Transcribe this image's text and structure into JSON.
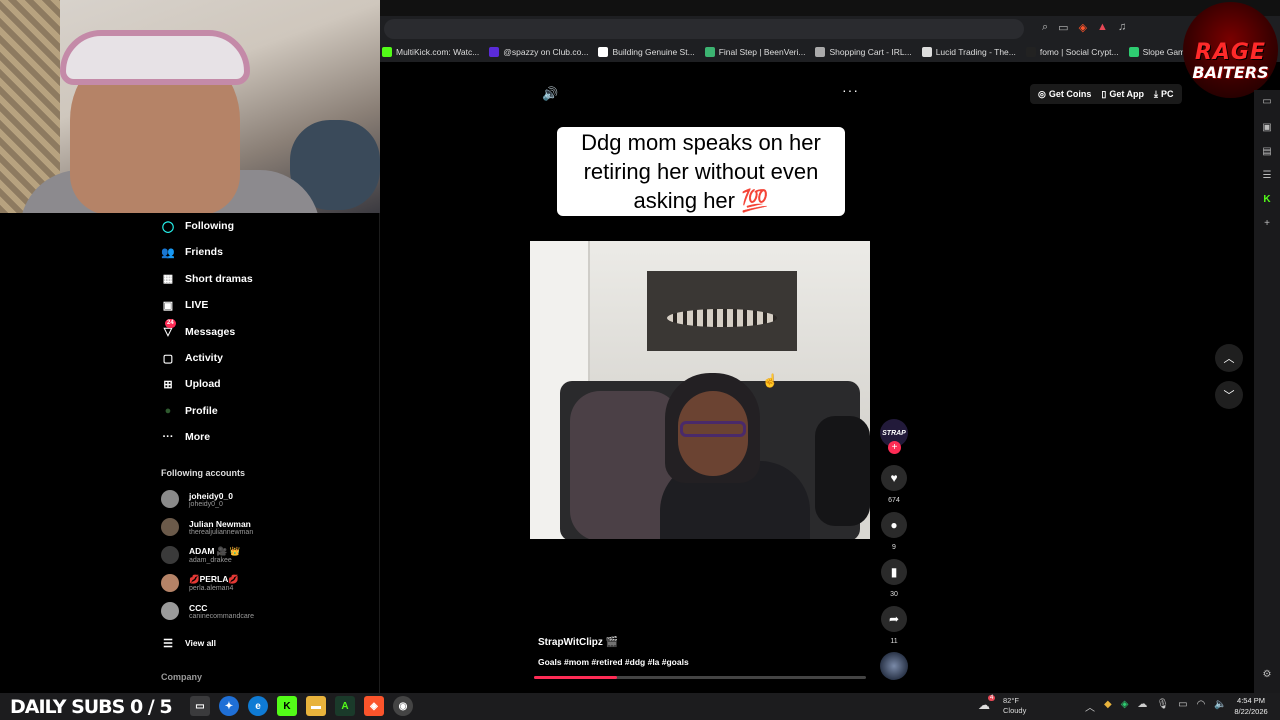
{
  "browser": {
    "bookmarks": [
      {
        "label": "MultiKick.com: Watc...",
        "color": "#53fc18",
        "icon": "kick-icon"
      },
      {
        "label": "@spazzy on Club.co...",
        "color": "#5a2bd9",
        "icon": "club-icon"
      },
      {
        "label": "Building Genuine St...",
        "color": "#ffffff",
        "icon": "globe-icon"
      },
      {
        "label": "Final Step | BeenVeri...",
        "color": "#3cb371",
        "icon": "beenverified-icon"
      },
      {
        "label": "Shopping Cart - IRL...",
        "color": "#aaaaaa",
        "icon": "globe-icon"
      },
      {
        "label": "Lucid Trading - The...",
        "color": "#dddddd",
        "icon": "lucid-icon"
      },
      {
        "label": "fomo | Social Crypt...",
        "color": "#222222",
        "icon": "fomo-icon"
      },
      {
        "label": "Slope Game",
        "color": "#2ecc71",
        "icon": "slope-icon"
      }
    ]
  },
  "logo": {
    "line1": "RAGE",
    "line2": "BAITERS"
  },
  "header_actions": {
    "coins": "Get Coins",
    "app": "Get App",
    "pc": "PC"
  },
  "sidebar": {
    "items": [
      {
        "label": "Following",
        "icon": "following-icon",
        "glyph": "◯"
      },
      {
        "label": "Friends",
        "icon": "friends-icon",
        "glyph": "👥"
      },
      {
        "label": "Short dramas",
        "icon": "short-dramas-icon",
        "glyph": "▦"
      },
      {
        "label": "LIVE",
        "icon": "live-icon",
        "glyph": "▣"
      },
      {
        "label": "Messages",
        "icon": "messages-icon",
        "glyph": "▽",
        "badge": "24"
      },
      {
        "label": "Activity",
        "icon": "activity-icon",
        "glyph": "▢"
      },
      {
        "label": "Upload",
        "icon": "upload-icon",
        "glyph": "⊞"
      },
      {
        "label": "Profile",
        "icon": "profile-avatar-icon",
        "glyph": "●"
      },
      {
        "label": "More",
        "icon": "more-dots-icon",
        "glyph": "···"
      }
    ],
    "following_title": "Following accounts",
    "accounts": [
      {
        "name": "joheidy0_0",
        "handle": "joheidy0_0"
      },
      {
        "name": "Julian Newman",
        "handle": "therealjuliannewman"
      },
      {
        "name": "ADAM 🎥 👑",
        "handle": "adam_drakee"
      },
      {
        "name": "💋PERLA💋",
        "handle": "perla.aleman4"
      },
      {
        "name": "CCC",
        "handle": "caninecommandcare"
      }
    ],
    "view_all": "View all",
    "company": "Company"
  },
  "video": {
    "caption": "Ddg mom speaks on her retiring her without even asking her 💯",
    "author": "StrapWitClipz 🎬",
    "description": "Goals #mom #retired #ddg #la #goals",
    "progress": 0.25,
    "creator_badge": "STRAP",
    "likes": "674",
    "comments": "9",
    "saves": "30",
    "shares": "11"
  },
  "taskbar": {
    "subs": "DAILY SUBS 0 / 5",
    "weather_temp": "82°F",
    "weather_desc": "Cloudy",
    "weather_badge": "4",
    "time": "4:54 PM",
    "date": "8/22/2026"
  }
}
